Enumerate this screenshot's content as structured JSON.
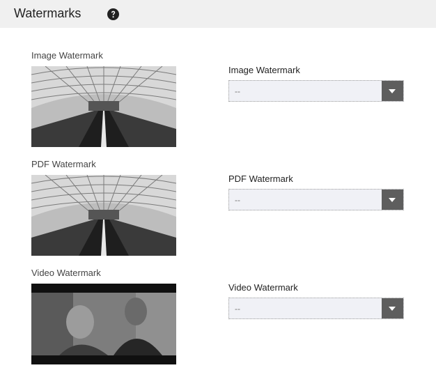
{
  "header": {
    "title": "Watermarks",
    "help_icon": "question-circle-icon"
  },
  "sections": [
    {
      "thumb_label": "Image Watermark",
      "field_label": "Image Watermark",
      "selected": "--",
      "thumbnail": "subway-station-photo"
    },
    {
      "thumb_label": "PDF Watermark",
      "field_label": "PDF Watermark",
      "selected": "--",
      "thumbnail": "subway-station-photo"
    },
    {
      "thumb_label": "Video Watermark",
      "field_label": "Video Watermark",
      "selected": "--",
      "thumbnail": "film-still-photo"
    }
  ],
  "colors": {
    "header_bg": "#f0f0f0",
    "select_bg": "#f0f1f6",
    "select_button": "#5e5e5e"
  }
}
